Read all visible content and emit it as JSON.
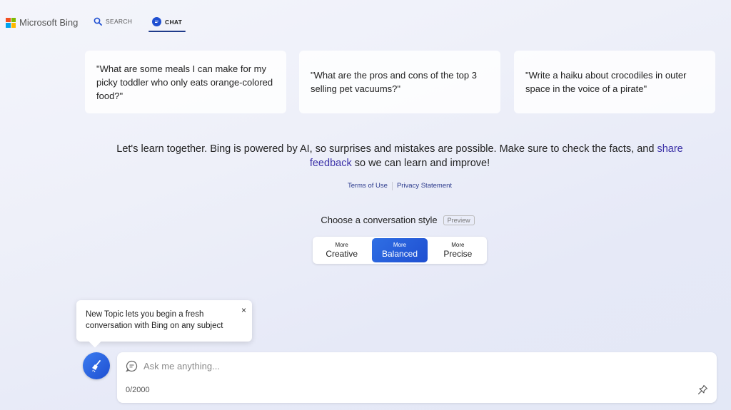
{
  "header": {
    "brand": "Microsoft Bing",
    "logo_colors": [
      "#f25022",
      "#7fba00",
      "#00a4ef",
      "#ffb900"
    ],
    "tabs": [
      {
        "label": "SEARCH",
        "icon": "search-icon"
      },
      {
        "label": "CHAT",
        "icon": "chat-icon",
        "active": true
      }
    ]
  },
  "suggestions": [
    "\"What are some meals I can make for my picky toddler who only eats orange-colored food?\"",
    "\"What are the pros and cons of the top 3 selling pet vacuums?\"",
    "\"Write a haiku about crocodiles in outer space in the voice of a pirate\""
  ],
  "disclaimer": {
    "text_before": "Let's learn together. Bing is powered by AI, so surprises and mistakes are possible. Make sure to check the facts, and ",
    "link": "share feedback",
    "text_after": " so we can learn and improve!"
  },
  "legal_links": [
    "Terms of Use",
    "Privacy Statement"
  ],
  "conversation_style": {
    "label": "Choose a conversation style",
    "badge": "Preview",
    "options": [
      {
        "small": "More",
        "big": "Creative"
      },
      {
        "small": "More",
        "big": "Balanced",
        "selected": true
      },
      {
        "small": "More",
        "big": "Precise"
      }
    ]
  },
  "tooltip": {
    "text": "New Topic lets you begin a fresh conversation with Bing on any subject",
    "close_glyph": "×"
  },
  "composer": {
    "placeholder": "Ask me anything...",
    "value": "",
    "counter": "0/2000"
  },
  "colors": {
    "accent": "#1f4fd1",
    "link": "#3b31a8"
  }
}
